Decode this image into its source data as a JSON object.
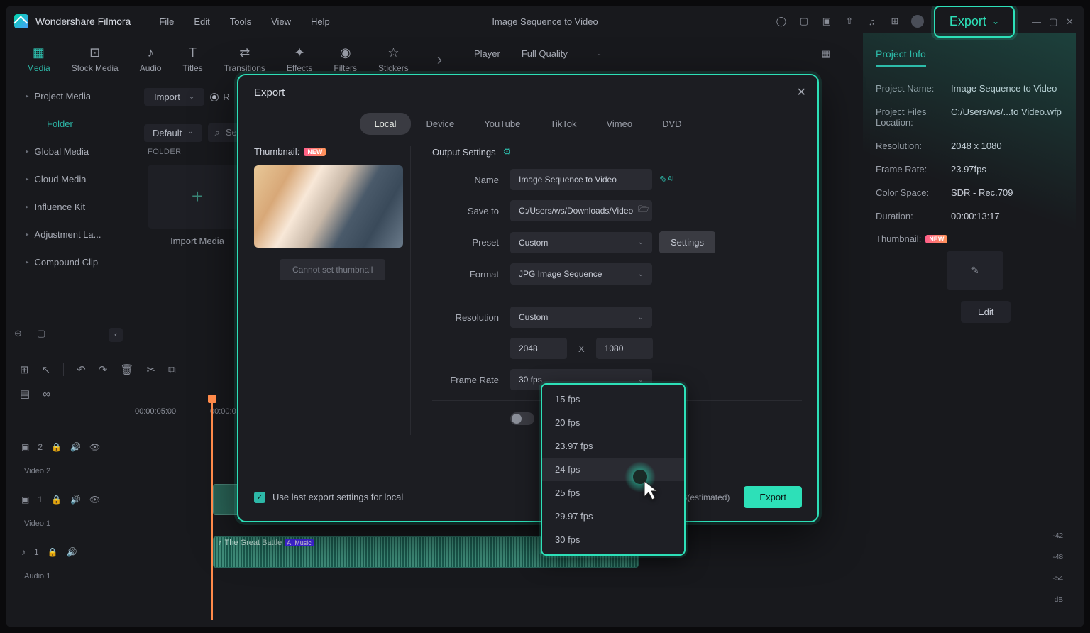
{
  "app": {
    "name": "Wondershare Filmora",
    "document_title": "Image Sequence to Video"
  },
  "menu": [
    "File",
    "Edit",
    "Tools",
    "View",
    "Help"
  ],
  "export_button": "Export",
  "tool_tabs": [
    "Media",
    "Stock Media",
    "Audio",
    "Titles",
    "Transitions",
    "Effects",
    "Filters",
    "Stickers"
  ],
  "preview": {
    "label": "Player",
    "quality": "Full Quality"
  },
  "secondary": {
    "import": "Import",
    "record": "R"
  },
  "third": {
    "sort": "Default",
    "search": "Se"
  },
  "sidebar": {
    "items": [
      "Project Media",
      "Folder",
      "Global Media",
      "Cloud Media",
      "Influence Kit",
      "Adjustment La...",
      "Compound Clip"
    ]
  },
  "media_area": {
    "folder_label": "FOLDER",
    "import_label": "Import Media"
  },
  "info": {
    "title": "Project Info",
    "rows": {
      "name_lbl": "Project Name:",
      "name_val": "Image Sequence to Video",
      "loc_lbl": "Project Files Location:",
      "loc_val": "C:/Users/ws/...to Video.wfp",
      "res_lbl": "Resolution:",
      "res_val": "2048 x 1080",
      "fr_lbl": "Frame Rate:",
      "fr_val": "23.97fps",
      "cs_lbl": "Color Space:",
      "cs_val": "SDR - Rec.709",
      "dur_lbl": "Duration:",
      "dur_val": "00:00:13:17"
    },
    "thumbnail_lbl": "Thumbnail:",
    "edit_btn": "Edit",
    "badge": "NEW"
  },
  "timeline": {
    "times": [
      "00:00:05:00",
      "00:00:0"
    ],
    "tracks": {
      "video2_lbl": "Video 2",
      "video2_idx": "2",
      "video1_lbl": "Video 1",
      "video1_idx": "1",
      "audio1_lbl": "Audio 1",
      "audio1_idx": "1"
    },
    "audio_clip": "The Great Battle",
    "ai_tag": "AI Music"
  },
  "meters": [
    "-42",
    "-48",
    "-54",
    "dB"
  ],
  "modal": {
    "title": "Export",
    "tabs": [
      "Local",
      "Device",
      "YouTube",
      "TikTok",
      "Vimeo",
      "DVD"
    ],
    "thumbnail_label": "Thumbnail:",
    "badge": "NEW",
    "cant_set": "Cannot set thumbnail",
    "settings_header": "Output Settings",
    "fields": {
      "name_lbl": "Name",
      "name_val": "Image Sequence to Video",
      "save_lbl": "Save to",
      "save_val": "C:/Users/ws/Downloads/Video",
      "preset_lbl": "Preset",
      "preset_val": "Custom",
      "settings_btn": "Settings",
      "format_lbl": "Format",
      "format_val": "JPG Image Sequence",
      "resolution_lbl": "Resolution",
      "resolution_val": "Custom",
      "res_w": "2048",
      "res_x": "X",
      "res_h": "1080",
      "framerate_lbl": "Frame Rate",
      "framerate_val": "30 fps"
    },
    "checkbox_label": "Use last export settings for local",
    "size_estimate": "MB(estimated)",
    "export_btn": "Export"
  },
  "fps_options": [
    "15 fps",
    "20 fps",
    "23.97 fps",
    "24 fps",
    "25 fps",
    "29.97 fps",
    "30 fps"
  ]
}
